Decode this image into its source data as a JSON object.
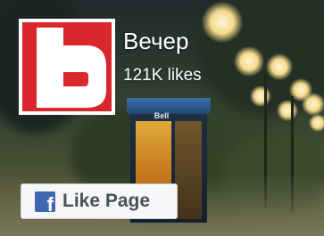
{
  "page": {
    "name": "Вечер",
    "likes": "121K likes"
  },
  "cover": {
    "booth_sign": "Bell"
  },
  "actions": {
    "like_page_label": "Like Page"
  },
  "icons": {
    "facebook": "facebook-f-icon",
    "logo": "brand-logo"
  },
  "colors": {
    "brand_red": "#d9272e",
    "facebook_blue": "#4267b2",
    "button_bg": "#f6f7f9",
    "button_text": "#4b4f56"
  }
}
